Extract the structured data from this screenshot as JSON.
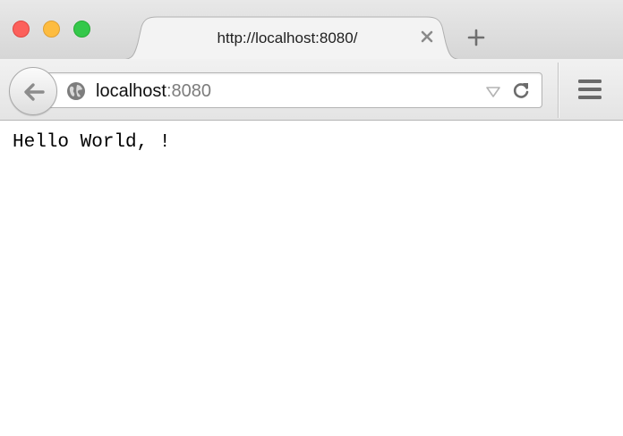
{
  "window": {
    "controls": {
      "close_color": "#fc605b",
      "minimize_color": "#fdbc40",
      "zoom_color": "#34c84a"
    }
  },
  "tab": {
    "title": "http://localhost:8080/",
    "close_icon": "close-x-icon"
  },
  "new_tab_icon": "plus-icon",
  "toolbar": {
    "back_icon": "back-arrow-icon",
    "url": {
      "site_icon": "globe-icon",
      "host": "localhost",
      "port": ":8080"
    },
    "dropdown_icon": "dropdown-triangle-icon",
    "reload_icon": "reload-icon",
    "menu_icon": "hamburger-menu-icon"
  },
  "page": {
    "body_text": "Hello World, !"
  }
}
